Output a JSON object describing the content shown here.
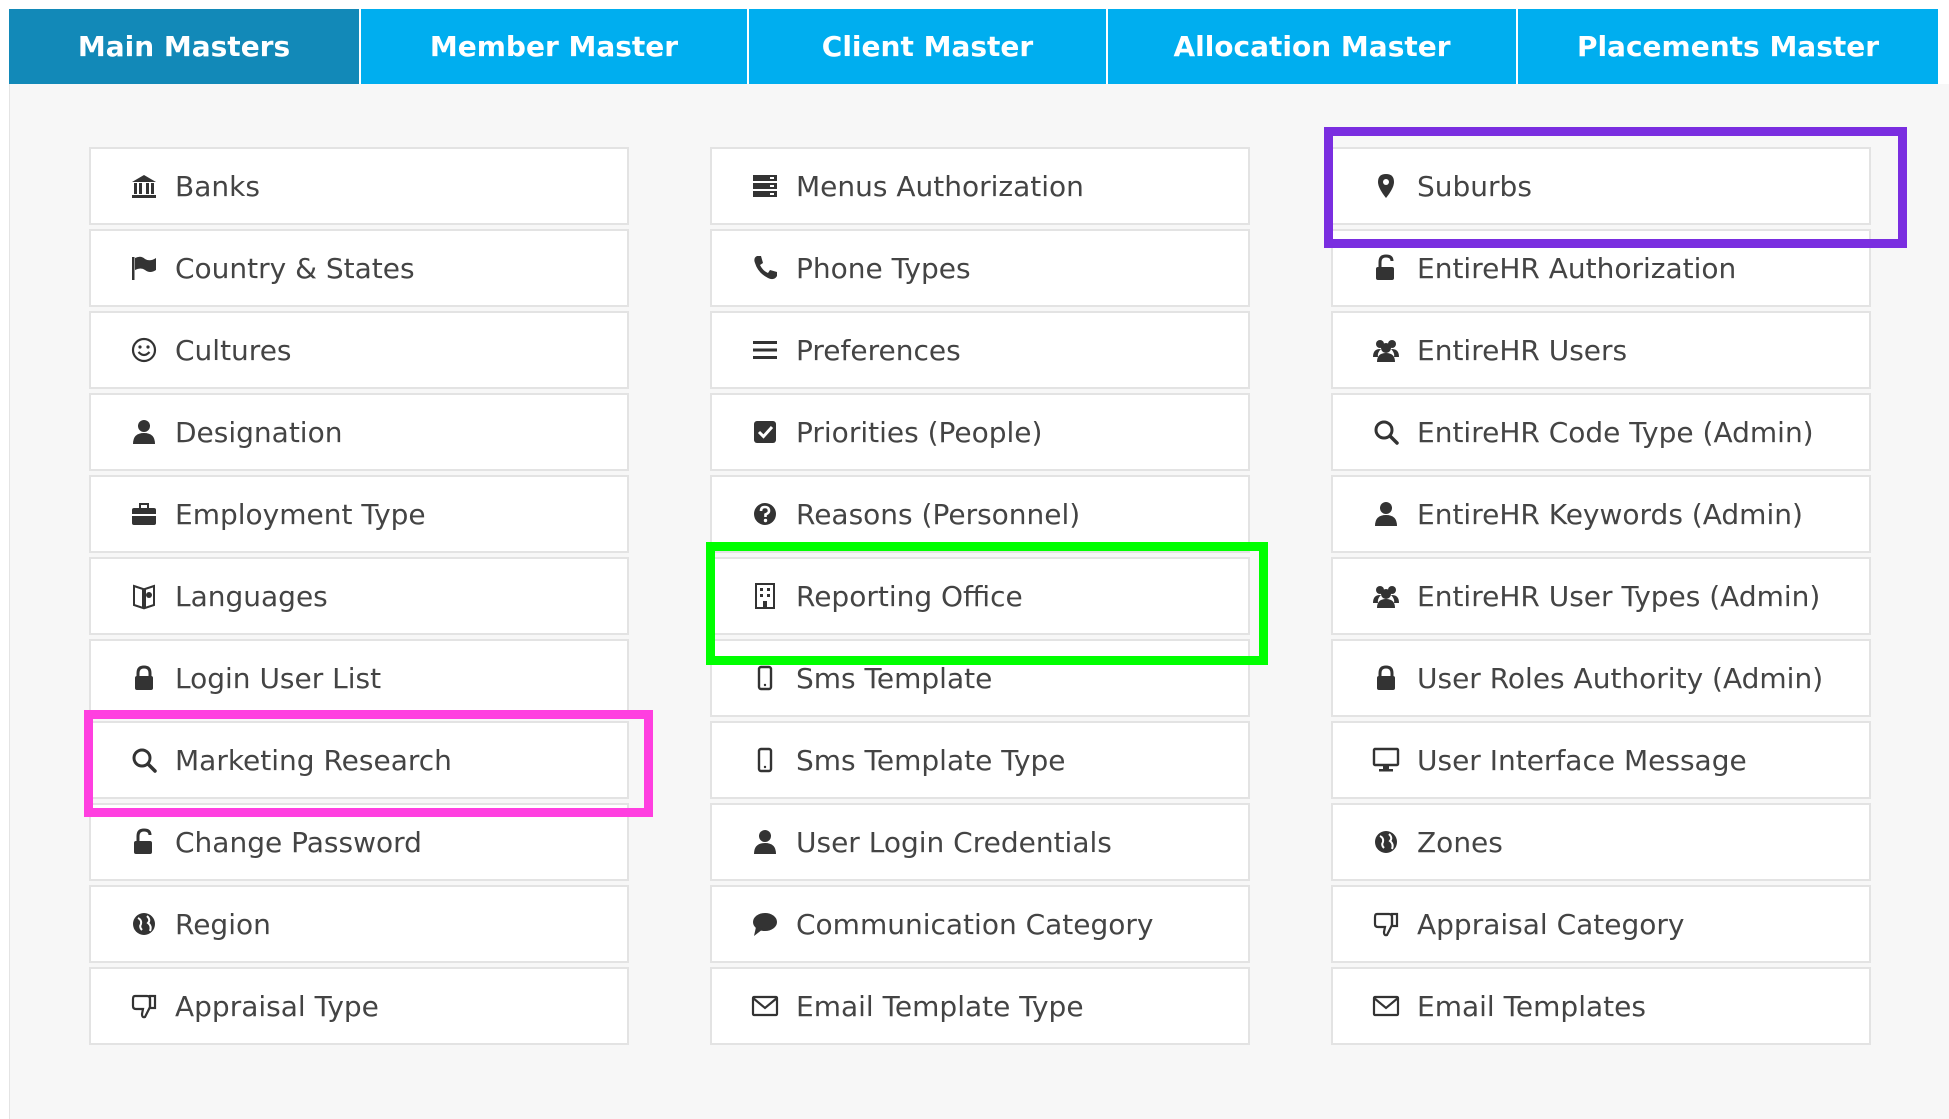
{
  "tabs": [
    {
      "label": "Main Masters",
      "active": true
    },
    {
      "label": "Member Master"
    },
    {
      "label": "Client Master"
    },
    {
      "label": "Allocation Master"
    },
    {
      "label": "Placements Master"
    }
  ],
  "columns": [
    [
      {
        "label": "Banks",
        "icon": "bank-icon"
      },
      {
        "label": "Country & States",
        "icon": "flag-icon"
      },
      {
        "label": "Cultures",
        "icon": "smiley-icon"
      },
      {
        "label": "Designation",
        "icon": "user-icon"
      },
      {
        "label": "Employment Type",
        "icon": "briefcase-icon"
      },
      {
        "label": "Languages",
        "icon": "globe-book-icon"
      },
      {
        "label": "Login User List",
        "icon": "lock-icon"
      },
      {
        "label": "Marketing Research",
        "icon": "search-icon"
      },
      {
        "label": "Change Password",
        "icon": "unlock-icon"
      },
      {
        "label": "Region",
        "icon": "globe-icon"
      },
      {
        "label": "Appraisal Type",
        "icon": "thumbs-down-icon"
      }
    ],
    [
      {
        "label": "Menus Authorization",
        "icon": "server-icon"
      },
      {
        "label": "Phone Types",
        "icon": "phone-icon"
      },
      {
        "label": "Preferences",
        "icon": "hamburger-icon"
      },
      {
        "label": "Priorities (People)",
        "icon": "checkbox-icon"
      },
      {
        "label": "Reasons (Personnel)",
        "icon": "question-icon"
      },
      {
        "label": "Reporting Office",
        "icon": "building-icon"
      },
      {
        "label": "Sms Template",
        "icon": "mobile-icon"
      },
      {
        "label": "Sms Template Type",
        "icon": "mobile-icon"
      },
      {
        "label": "User Login Credentials",
        "icon": "user-icon"
      },
      {
        "label": "Communication Category",
        "icon": "comment-icon"
      },
      {
        "label": "Email Template Type",
        "icon": "envelope-icon"
      }
    ],
    [
      {
        "label": "Suburbs",
        "icon": "map-marker-icon"
      },
      {
        "label": "EntireHR Authorization",
        "icon": "unlock-icon"
      },
      {
        "label": "EntireHR Users",
        "icon": "users-icon"
      },
      {
        "label": "EntireHR Code Type (Admin)",
        "icon": "search-icon"
      },
      {
        "label": "EntireHR Keywords (Admin)",
        "icon": "user-icon"
      },
      {
        "label": "EntireHR User Types (Admin)",
        "icon": "users-icon"
      },
      {
        "label": "User Roles Authority (Admin)",
        "icon": "lock-icon"
      },
      {
        "label": "User Interface Message",
        "icon": "monitor-icon"
      },
      {
        "label": "Zones",
        "icon": "globe-icon"
      },
      {
        "label": "Appraisal Category",
        "icon": "thumbs-down-icon"
      },
      {
        "label": "Email Templates",
        "icon": "envelope-icon"
      }
    ]
  ],
  "highlights": [
    {
      "name": "highlight-marketing-research",
      "color": "#ff3fe0"
    },
    {
      "name": "highlight-reporting-office",
      "color": "#00ff00"
    },
    {
      "name": "highlight-suburbs",
      "color": "#7a2ee0"
    }
  ],
  "colors": {
    "tab_bg": "#00aeef",
    "tab_active_bg": "#1289b8",
    "tab_text": "#ffffff",
    "panel_bg": "#f7f7f7",
    "item_text": "#444444",
    "icon": "#333333"
  }
}
